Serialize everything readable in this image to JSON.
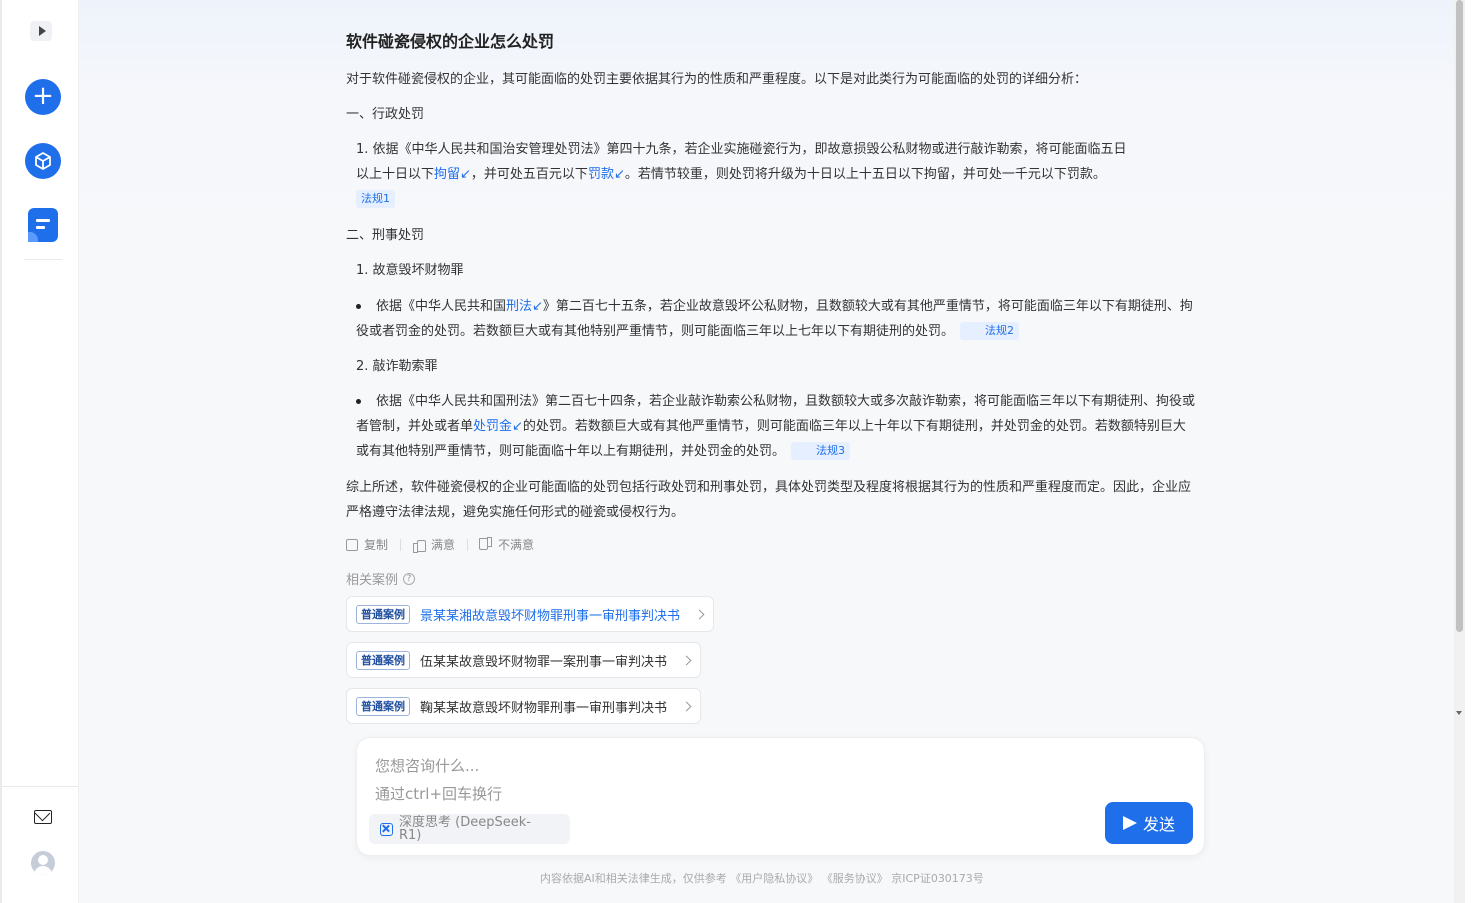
{
  "question": {
    "title": "软件碰瓷侵权的企业怎么处罚"
  },
  "answer": {
    "intro": "对于软件碰瓷侵权的企业，其可能面临的处罚主要依据其行为的性质和严重程度。以下是对此类行为可能面临的处罚的详细分析：",
    "section1": "一、行政处罚",
    "item1_line1": "1. 依据《中华人民共和国治安管理处罚法》第四十九条，若企业实施碰瓷行为，即故意损毁公私财物或进行敲诈勒索，将可能面临五日",
    "item1_line2_a": "以上十日以下",
    "item1_link1": "拘留↙",
    "item1_line2_b": "，并可处五百元以下",
    "item1_link2": "罚款↙",
    "item1_line2_c": "。若情节较重，则处罚将升级为十日以上十五日以下拘留，并可处一千元以下罚款。",
    "tag1": "法规1",
    "section2": "二、刑事处罚",
    "sub1": "1. 故意毁坏财物罪",
    "bullet1_a": "依据《中华人民共和国",
    "bullet1_link": "刑法↙",
    "bullet1_b": "》第二百七十五条，若企业故意毁坏公私财物，且数额较大或有其他严重情节，将可能面临三年以下有期徒刑、拘役或者罚金的处罚。若数额巨大或有其他特别严重情节，则可能面临三年以上七年以下有期徒刑的处罚。",
    "tag2": "法规2",
    "sub2": "2. 敲诈勒索罪",
    "bullet2_a": "依据《中华人民共和国刑法》第二百七十四条，若企业敲诈勒索公私财物，且数额较大或多次敲诈勒索，将可能面临三年以下有期徒刑、拘役或者管制，并处或者单",
    "bullet2_link": "处罚金↙",
    "bullet2_b": "的处罚。若数额巨大或有其他严重情节，则可能面临三年以上十年以下有期徒刑，并处罚金的处罚。若数额特别巨大或有其他特别严重情节，则可能面临十年以上有期徒刑，并处罚金的处罚。",
    "tag3": "法规3",
    "summary": "综上所述，软件碰瓷侵权的企业可能面临的处罚包括行政处罚和刑事处罚，具体处罚类型及程度将根据其行为的性质和严重程度而定。因此，企业应严格遵守法律法规，避免实施任何形式的碰瓷或侵权行为。"
  },
  "actions": {
    "copy": "复制",
    "like": "满意",
    "dislike": "不满意"
  },
  "related": {
    "title": "相关案例",
    "help_glyph": "?",
    "cases": [
      {
        "badge": "普通案例",
        "name": "景某某湘故意毁坏财物罪刑事一审刑事判决书"
      },
      {
        "badge": "普通案例",
        "name": "伍某某故意毁坏财物罪一案刑事一审判决书"
      },
      {
        "badge": "普通案例",
        "name": "鞠某某故意毁坏财物罪刑事一审刑事判决书"
      }
    ]
  },
  "input": {
    "placeholder": "您想咨询什么...\n通过ctrl+回车换行",
    "deep_think": "深度思考 (DeepSeek-R1)",
    "send": "发送"
  },
  "footer": {
    "text": "内容依据AI和相关法律生成，仅供参考  《用户隐私协议》 《服务协议》  京ICP证030173号"
  },
  "colors": {
    "accent": "#1f6feb",
    "background": "#f7f8fa"
  },
  "icons": [
    "sidebar-toggle-icon",
    "plus-icon",
    "cube-icon",
    "document-icon",
    "mail-icon",
    "user-avatar-icon",
    "copy-icon",
    "thumb-up-icon",
    "thumb-down-icon",
    "help-icon",
    "chevron-right-icon",
    "deep-think-icon",
    "send-icon"
  ]
}
